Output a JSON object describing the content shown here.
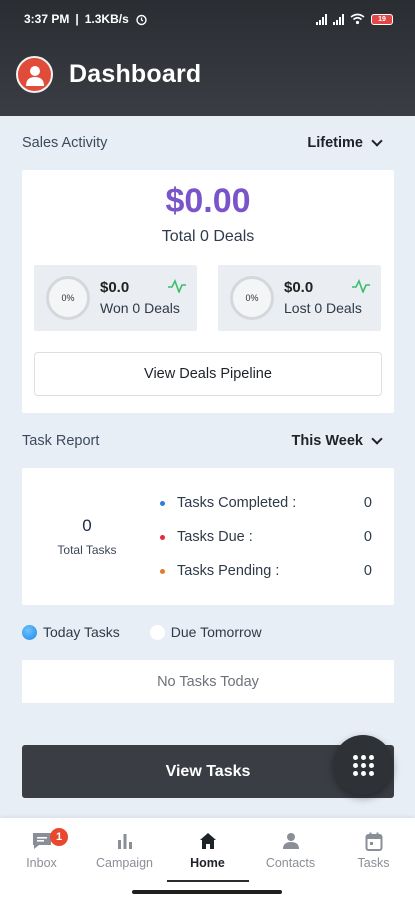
{
  "status_bar": {
    "time": "3:37 PM",
    "network_speed": "1.3KB/s",
    "battery_level": "19"
  },
  "header": {
    "title": "Dashboard"
  },
  "sales_activity": {
    "label": "Sales Activity",
    "period": "Lifetime",
    "total_amount": "$0.00",
    "total_deals": "Total 0 Deals",
    "won": {
      "percent": "0%",
      "amount": "$0.0",
      "label": "Won 0 Deals"
    },
    "lost": {
      "percent": "0%",
      "amount": "$0.0",
      "label": "Lost 0 Deals"
    },
    "pipeline_button": "View Deals Pipeline"
  },
  "task_report": {
    "label": "Task Report",
    "period": "This Week",
    "total_count": "0",
    "total_label": "Total Tasks",
    "items": [
      {
        "label": "Tasks Completed :",
        "value": "0",
        "color": "#2f7de1"
      },
      {
        "label": "Tasks Due :",
        "value": "0",
        "color": "#e8283c"
      },
      {
        "label": "Tasks Pending :",
        "value": "0",
        "color": "#e07a2c"
      }
    ]
  },
  "task_tabs": {
    "today": {
      "label": "Today Tasks",
      "color": "#1e88e5"
    },
    "tomorrow": {
      "label": "Due Tomorrow",
      "color": "#ffffff"
    }
  },
  "empty_message": "No Tasks Today",
  "view_tasks_button": "View Tasks",
  "bottom_nav": {
    "inbox": {
      "label": "Inbox",
      "badge": "1"
    },
    "campaign": {
      "label": "Campaign"
    },
    "home": {
      "label": "Home"
    },
    "contacts": {
      "label": "Contacts"
    },
    "tasks": {
      "label": "Tasks"
    }
  },
  "colors": {
    "accent_purple": "#7a55c9",
    "header_dark": "#2a2d32",
    "trend_green": "#3bbf6a"
  }
}
